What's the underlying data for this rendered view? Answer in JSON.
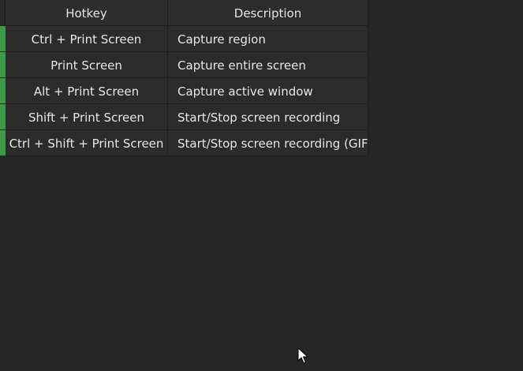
{
  "table": {
    "columns": {
      "hotkey": "Hotkey",
      "description": "Description"
    },
    "rows": [
      {
        "hotkey": "Ctrl + Print Screen",
        "description": "Capture region"
      },
      {
        "hotkey": "Print Screen",
        "description": "Capture entire screen"
      },
      {
        "hotkey": "Alt + Print Screen",
        "description": "Capture active window"
      },
      {
        "hotkey": "Shift + Print Screen",
        "description": "Start/Stop screen recording"
      },
      {
        "hotkey": "Ctrl + Shift + Print Screen",
        "description": "Start/Stop screen recording (GIF)"
      }
    ],
    "row_marker_color": "#3d9b47"
  },
  "cursor": {
    "icon": "mouse-pointer-icon"
  }
}
